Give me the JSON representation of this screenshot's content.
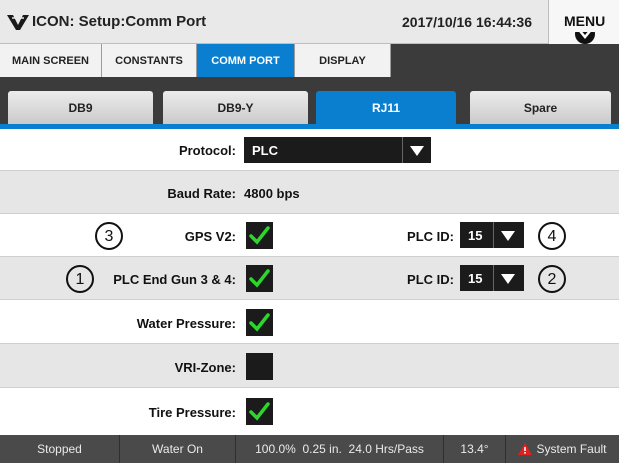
{
  "header": {
    "title": "ICON: Setup:Comm Port",
    "datetime": "2017/10/16 16:44:36",
    "menu_label": "MENU"
  },
  "tabs": [
    {
      "label": "MAIN SCREEN",
      "active": false
    },
    {
      "label": "CONSTANTS",
      "active": false
    },
    {
      "label": "COMM PORT",
      "active": true
    },
    {
      "label": "DISPLAY",
      "active": false
    }
  ],
  "port_tabs": [
    {
      "label": "DB9",
      "active": false
    },
    {
      "label": "DB9-Y",
      "active": false
    },
    {
      "label": "RJ11",
      "active": true
    },
    {
      "label": "Spare",
      "active": false
    }
  ],
  "protocol": {
    "label": "Protocol:",
    "value": "PLC"
  },
  "baud_rate": {
    "label": "Baud Rate:",
    "value": "4800 bps"
  },
  "gps_v2": {
    "label": "GPS V2:",
    "checked": true,
    "callout": "3",
    "plc_id_label": "PLC ID:",
    "plc_id": "15",
    "plc_callout": "4"
  },
  "plc_end_gun": {
    "label": "PLC End Gun 3 & 4:",
    "checked": true,
    "callout": "1",
    "plc_id_label": "PLC ID:",
    "plc_id": "15",
    "plc_callout": "2"
  },
  "water_pressure": {
    "label": "Water Pressure:",
    "checked": true
  },
  "vri_zone": {
    "label": "VRI-Zone:",
    "checked": false
  },
  "tire_pressure": {
    "label": "Tire Pressure:",
    "checked": true
  },
  "status": {
    "state": "Stopped",
    "water": "Water On",
    "percent": "100.0%",
    "depth": "0.25 in.",
    "hrs_pass": "24.0 Hrs/Pass",
    "angle": "13.4°",
    "fault": "System Fault"
  },
  "colors": {
    "accent": "#0a7fd0",
    "check": "#2dd62d",
    "warning": "#e02020"
  }
}
